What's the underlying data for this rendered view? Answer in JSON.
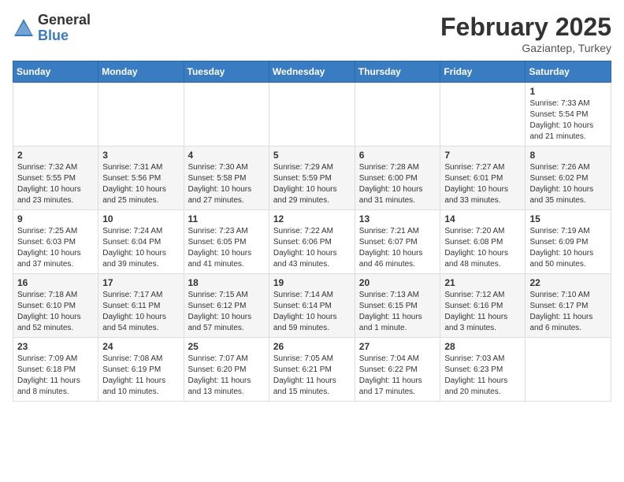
{
  "logo": {
    "general": "General",
    "blue": "Blue"
  },
  "title": {
    "month": "February 2025",
    "location": "Gaziantep, Turkey"
  },
  "headers": [
    "Sunday",
    "Monday",
    "Tuesday",
    "Wednesday",
    "Thursday",
    "Friday",
    "Saturday"
  ],
  "weeks": [
    [
      {
        "day": "",
        "info": ""
      },
      {
        "day": "",
        "info": ""
      },
      {
        "day": "",
        "info": ""
      },
      {
        "day": "",
        "info": ""
      },
      {
        "day": "",
        "info": ""
      },
      {
        "day": "",
        "info": ""
      },
      {
        "day": "1",
        "info": "Sunrise: 7:33 AM\nSunset: 5:54 PM\nDaylight: 10 hours and 21 minutes."
      }
    ],
    [
      {
        "day": "2",
        "info": "Sunrise: 7:32 AM\nSunset: 5:55 PM\nDaylight: 10 hours and 23 minutes."
      },
      {
        "day": "3",
        "info": "Sunrise: 7:31 AM\nSunset: 5:56 PM\nDaylight: 10 hours and 25 minutes."
      },
      {
        "day": "4",
        "info": "Sunrise: 7:30 AM\nSunset: 5:58 PM\nDaylight: 10 hours and 27 minutes."
      },
      {
        "day": "5",
        "info": "Sunrise: 7:29 AM\nSunset: 5:59 PM\nDaylight: 10 hours and 29 minutes."
      },
      {
        "day": "6",
        "info": "Sunrise: 7:28 AM\nSunset: 6:00 PM\nDaylight: 10 hours and 31 minutes."
      },
      {
        "day": "7",
        "info": "Sunrise: 7:27 AM\nSunset: 6:01 PM\nDaylight: 10 hours and 33 minutes."
      },
      {
        "day": "8",
        "info": "Sunrise: 7:26 AM\nSunset: 6:02 PM\nDaylight: 10 hours and 35 minutes."
      }
    ],
    [
      {
        "day": "9",
        "info": "Sunrise: 7:25 AM\nSunset: 6:03 PM\nDaylight: 10 hours and 37 minutes."
      },
      {
        "day": "10",
        "info": "Sunrise: 7:24 AM\nSunset: 6:04 PM\nDaylight: 10 hours and 39 minutes."
      },
      {
        "day": "11",
        "info": "Sunrise: 7:23 AM\nSunset: 6:05 PM\nDaylight: 10 hours and 41 minutes."
      },
      {
        "day": "12",
        "info": "Sunrise: 7:22 AM\nSunset: 6:06 PM\nDaylight: 10 hours and 43 minutes."
      },
      {
        "day": "13",
        "info": "Sunrise: 7:21 AM\nSunset: 6:07 PM\nDaylight: 10 hours and 46 minutes."
      },
      {
        "day": "14",
        "info": "Sunrise: 7:20 AM\nSunset: 6:08 PM\nDaylight: 10 hours and 48 minutes."
      },
      {
        "day": "15",
        "info": "Sunrise: 7:19 AM\nSunset: 6:09 PM\nDaylight: 10 hours and 50 minutes."
      }
    ],
    [
      {
        "day": "16",
        "info": "Sunrise: 7:18 AM\nSunset: 6:10 PM\nDaylight: 10 hours and 52 minutes."
      },
      {
        "day": "17",
        "info": "Sunrise: 7:17 AM\nSunset: 6:11 PM\nDaylight: 10 hours and 54 minutes."
      },
      {
        "day": "18",
        "info": "Sunrise: 7:15 AM\nSunset: 6:12 PM\nDaylight: 10 hours and 57 minutes."
      },
      {
        "day": "19",
        "info": "Sunrise: 7:14 AM\nSunset: 6:14 PM\nDaylight: 10 hours and 59 minutes."
      },
      {
        "day": "20",
        "info": "Sunrise: 7:13 AM\nSunset: 6:15 PM\nDaylight: 11 hours and 1 minute."
      },
      {
        "day": "21",
        "info": "Sunrise: 7:12 AM\nSunset: 6:16 PM\nDaylight: 11 hours and 3 minutes."
      },
      {
        "day": "22",
        "info": "Sunrise: 7:10 AM\nSunset: 6:17 PM\nDaylight: 11 hours and 6 minutes."
      }
    ],
    [
      {
        "day": "23",
        "info": "Sunrise: 7:09 AM\nSunset: 6:18 PM\nDaylight: 11 hours and 8 minutes."
      },
      {
        "day": "24",
        "info": "Sunrise: 7:08 AM\nSunset: 6:19 PM\nDaylight: 11 hours and 10 minutes."
      },
      {
        "day": "25",
        "info": "Sunrise: 7:07 AM\nSunset: 6:20 PM\nDaylight: 11 hours and 13 minutes."
      },
      {
        "day": "26",
        "info": "Sunrise: 7:05 AM\nSunset: 6:21 PM\nDaylight: 11 hours and 15 minutes."
      },
      {
        "day": "27",
        "info": "Sunrise: 7:04 AM\nSunset: 6:22 PM\nDaylight: 11 hours and 17 minutes."
      },
      {
        "day": "28",
        "info": "Sunrise: 7:03 AM\nSunset: 6:23 PM\nDaylight: 11 hours and 20 minutes."
      },
      {
        "day": "",
        "info": ""
      }
    ]
  ]
}
